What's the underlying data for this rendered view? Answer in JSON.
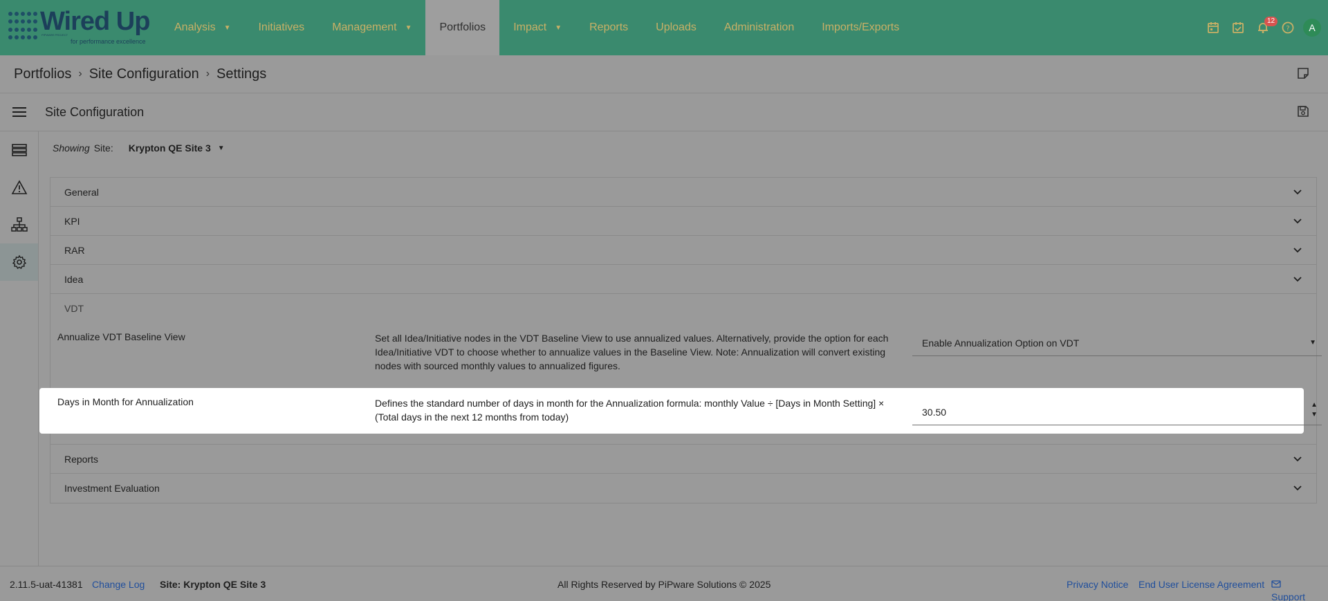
{
  "brand": {
    "name": "Wired Up",
    "tagline": "for performance excellence",
    "small_text": "PIPWARE PROJECT"
  },
  "nav": {
    "items": [
      {
        "label": "Analysis",
        "caret": true
      },
      {
        "label": "Initiatives",
        "caret": false
      },
      {
        "label": "Management",
        "caret": true
      },
      {
        "label": "Portfolios",
        "caret": false,
        "active": true
      },
      {
        "label": "Impact",
        "caret": true
      },
      {
        "label": "Reports",
        "caret": false
      },
      {
        "label": "Uploads",
        "caret": false
      },
      {
        "label": "Administration",
        "caret": false
      },
      {
        "label": "Imports/Exports",
        "caret": false
      }
    ],
    "notification_count": "12",
    "avatar_initial": "A"
  },
  "breadcrumb": {
    "items": [
      "Portfolios",
      "Site Configuration",
      "Settings"
    ]
  },
  "page": {
    "title": "Site Configuration"
  },
  "filter": {
    "showing_label": "Showing",
    "site_label": "Site:",
    "site_value": "Krypton QE Site 3"
  },
  "sections": {
    "general": "General",
    "kpi": "KPI",
    "rar": "RAR",
    "idea": "Idea",
    "vdt": "VDT",
    "reports": "Reports",
    "investment": "Investment Evaluation"
  },
  "vdt_settings": {
    "annualize": {
      "label": "Annualize VDT Baseline View",
      "description": "Set all Idea/Initiative nodes in the VDT Baseline View to use annualized values. Alternatively, provide the option for each Idea/Initiative VDT to choose whether to annualize values in the Baseline View. Note: Annualization will convert existing nodes with sourced monthly values to annualized figures.",
      "value": "Enable Annualization Option on VDT"
    },
    "days": {
      "label": "Days in Month for Annualization",
      "description": "Defines the standard number of days in month for the Annualization formula: monthly Value ÷ [Days in Month Setting] × (Total days in the next 12 months from today)",
      "value": "30.50"
    }
  },
  "footer": {
    "version": "2.11.5-uat-41381",
    "changelog": "Change Log",
    "site": "Site: Krypton QE Site 3",
    "copyright": "All Rights Reserved by PiPware Solutions © 2025",
    "privacy": "Privacy Notice",
    "eula": "End User License Agreement",
    "support": "Support"
  },
  "colors": {
    "nav_bg": "#3a8a6e",
    "nav_text": "#c9b066",
    "link": "#1f4e9c",
    "badge": "#d9534f"
  }
}
